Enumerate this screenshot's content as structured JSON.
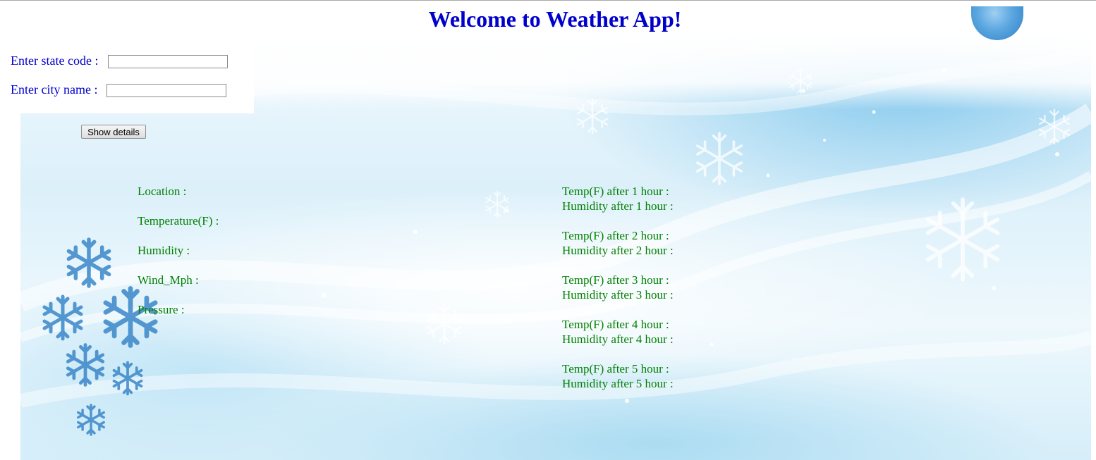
{
  "header": {
    "title": "Welcome to Weather App!"
  },
  "form": {
    "state": {
      "label": "Enter state code :",
      "value": ""
    },
    "city": {
      "label": "Enter city name :",
      "value": ""
    },
    "submit_label": "Show details"
  },
  "current": {
    "location_label": "Location :",
    "temperature_label": "Temperature(F) :",
    "humidity_label": "Humidity :",
    "wind_label": "Wind_Mph :",
    "pressure_label": "Pressure :"
  },
  "forecast": [
    {
      "temp_label": "Temp(F) after 1 hour :",
      "humidity_label": "Humidity after 1 hour :"
    },
    {
      "temp_label": "Temp(F) after 2 hour :",
      "humidity_label": "Humidity after 2 hour :"
    },
    {
      "temp_label": "Temp(F) after 3 hour :",
      "humidity_label": "Humidity after 3 hour :"
    },
    {
      "temp_label": "Temp(F) after 4 hour :",
      "humidity_label": "Humidity after 4 hour :"
    },
    {
      "temp_label": "Temp(F) after 5 hour :",
      "humidity_label": "Humidity after 5 hour :"
    }
  ],
  "colors": {
    "heading": "#0000cc",
    "form_label": "#0000cc",
    "result_label": "#008000",
    "snowflake": "#3a86c8"
  },
  "decor": {
    "background": "winter-snowflake-wallpaper",
    "icon": "snowflake-icon"
  }
}
